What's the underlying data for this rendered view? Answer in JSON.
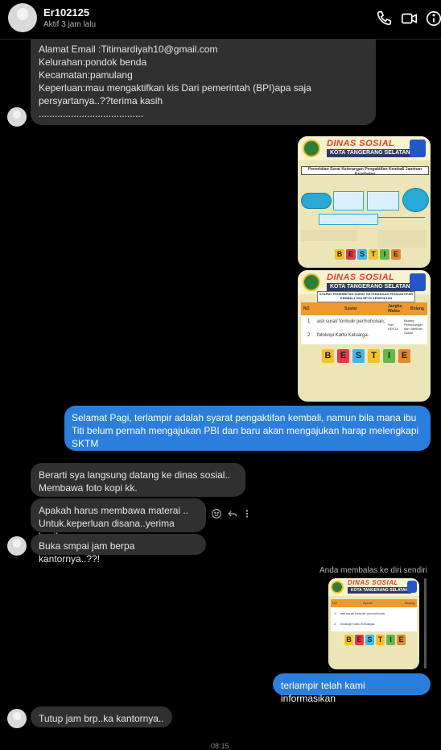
{
  "header": {
    "name": "Er102125",
    "status": "Aktif 3 jam lalu",
    "icons": [
      "phone-icon",
      "video-icon",
      "info-icon"
    ]
  },
  "messages": {
    "m1_lines": [
      "Alamat Email :Titimardiyah10@gmail.com",
      "Kelurahan:pondok benda",
      "Kecamatan:pamulang",
      "Keperluan:mau mengaktifkan kis Dari pemerintah (BPI)apa saja",
      "persyartanya..??terima kasih",
      "......................................."
    ],
    "m2": "Selamat Pagi, terlampir adalah syarat pengaktifan kembali, namun bila mana ibu Titi belum pernah mengajukan PBI dan baru akan mengajukan harap melengkapi SKTM",
    "m3_lines": [
      "Berarti sya langsung datang ke dinas sosial..",
      "Membawa foto kopi kk."
    ],
    "m4_lines": [
      "Apakah harus membawa materai ..",
      "Untuk.keperluan disana..yerima kasih"
    ],
    "m5": "Buka smpai jam berpa kantornya..??!",
    "reply_label": "Anda membalas ke diri sendiri",
    "m6": "terlampir telah kami informasikan",
    "m7": "Tutup jam brp..ka kantornya..",
    "time_stub": "08:15"
  },
  "poster": {
    "title": "DINAS SOSIAL",
    "subtitle": "KOTA TANGERANG SELATAN",
    "flow_title": "Penerbitan Surat Keterangan Pengaktifan Kembali Jaminan Kesehatan",
    "req_title": "SYARAT PENERBITAN SURAT KETERANGAN PENGAKTIFAN KEMBALI JKN BPJS KESEHATAN",
    "col_no": "NO",
    "col_syarat": "Syarat",
    "col_waktu": "Jangka Waktu",
    "col_bidang": "Bidang",
    "row1_no": "1",
    "row1": "asli surat/ formulir permohonan;",
    "row2_no": "2",
    "row2": "fotokopi Kartu Keluarga.",
    "waktu_val": "Hari KERJA",
    "bidang_val": "Bidang Perlindungan dan Jaminan Sosial",
    "bestie": [
      "B",
      "E",
      "S",
      "T",
      "I",
      "E"
    ]
  },
  "message_actions": [
    "emoji-icon",
    "reply-icon",
    "more-icon"
  ]
}
